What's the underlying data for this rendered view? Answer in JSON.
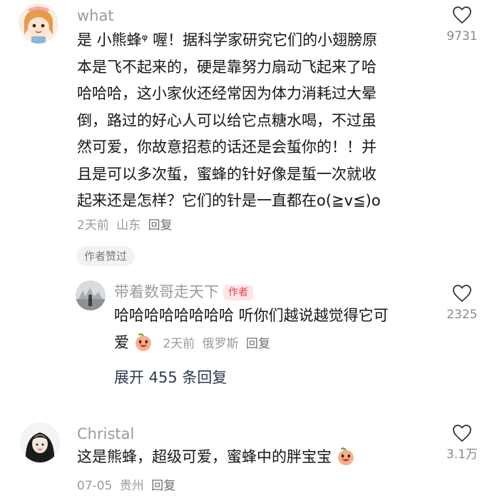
{
  "comments": [
    {
      "username": "what",
      "text": "是 小熊蜂🔍 喔！据科学家研究它们的小翅膀原本是飞不起来的，硬是靠努力扇动飞起来了哈哈哈哈，这小家伙还经常因为体力消耗过大晕倒，路过的好心人可以给它点糖水喝，不过虽然可爱，你故意招惹的话还是会蜇你的！！并且是可以多次蜇，蜜蜂的针好像是蜇一次就收起来还是怎样？它们的针是一直都在o(≧v≦)o",
      "text_lines": [
        "是 小熊蜂ᵠ 喔！据科学家研究它们的小翅膀原",
        "本是飞不起来的，硬是靠努力扇动飞起来了哈",
        "哈哈哈，这小家伙还经常因为体力消耗过大晕",
        "倒，路过的好心人可以给它点糖水喝，不过虽",
        "然可爱，你故意招惹的话还是会蜇你的！！并",
        "且是可以多次蜇，蜜蜂的针好像是蜇一次就收",
        "起来还是怎样？它们的针是一直都在o(≧v≦)o"
      ],
      "time": "2天前",
      "location": "山东",
      "reply_label": "回复",
      "likes": "9731",
      "liked_badge": "作者赞过"
    },
    {
      "username": "带着数哥走天下",
      "author_tag": "作者",
      "text_lines": [
        "哈哈哈哈哈哈哈哈 听你们越说越觉得它可",
        "爱"
      ],
      "time": "2天前",
      "location": "俄罗斯",
      "reply_label": "回复",
      "likes": "2325"
    },
    {
      "username": "Christal",
      "text_lines": [
        "这是熊蜂，超级可爱，蜜蜂中的胖宝宝"
      ],
      "time": "07-05",
      "location": "贵州",
      "reply_label": "回复",
      "likes": "3.1万"
    }
  ],
  "expand_replies": "展开 455 条回复",
  "icons": {
    "like": "heart-outline-icon",
    "emoji": "grinning-peach-emoji"
  },
  "colors": {
    "author_tag_bg": "#fde6e6",
    "author_tag_text": "#e8424a",
    "muted": "#9a9a9a"
  }
}
